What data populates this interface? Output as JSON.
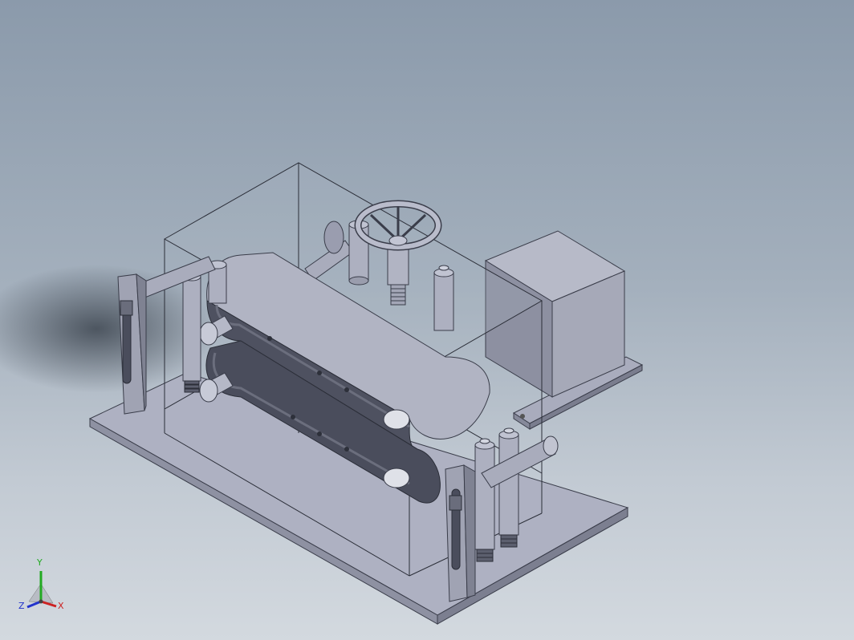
{
  "view_triad": {
    "x_label": "X",
    "y_label": "Y",
    "z_label": "Z",
    "colors": {
      "x": "#cc2222",
      "y": "#22aa22",
      "z": "#2233cc"
    }
  },
  "scene": {
    "background_top": "#8b9aab",
    "background_bottom": "#d3d9df",
    "part_color": "#b0b3c4"
  }
}
